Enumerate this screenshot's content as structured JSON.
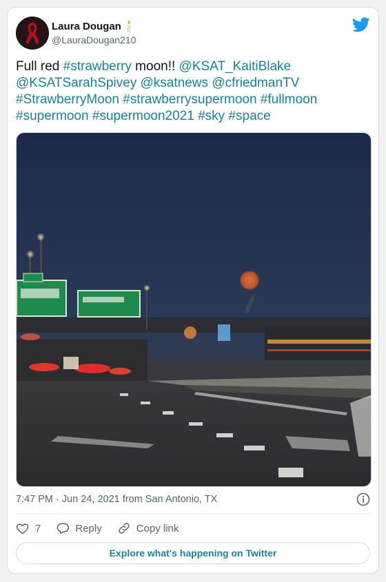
{
  "author": {
    "name": "Laura Dougan",
    "handle": "@LauraDougan210"
  },
  "tweet": {
    "parts": [
      {
        "t": "Full red ",
        "tag": false
      },
      {
        "t": "#strawberry",
        "tag": true
      },
      {
        "t": " moon!! ",
        "tag": false
      },
      {
        "t": "@KSAT_KaitiBlake",
        "tag": true
      },
      {
        "t": " ",
        "tag": false
      },
      {
        "t": "@KSATSarahSpivey",
        "tag": true
      },
      {
        "t": " ",
        "tag": false
      },
      {
        "t": "@ksatnews",
        "tag": true
      },
      {
        "t": " ",
        "tag": false
      },
      {
        "t": "@cfriedmanTV",
        "tag": true
      },
      {
        "t": " ",
        "tag": false
      },
      {
        "t": "#StrawberryMoon",
        "tag": true
      },
      {
        "t": " ",
        "tag": false
      },
      {
        "t": "#strawberrysupermoon",
        "tag": true
      },
      {
        "t": " ",
        "tag": false
      },
      {
        "t": "#fullmoon",
        "tag": true
      },
      {
        "t": " ",
        "tag": false
      },
      {
        "t": "#supermoon",
        "tag": true
      },
      {
        "t": " ",
        "tag": false
      },
      {
        "t": "#supermoon2021",
        "tag": true
      },
      {
        "t": " ",
        "tag": false
      },
      {
        "t": "#sky",
        "tag": true
      },
      {
        "t": " ",
        "tag": false
      },
      {
        "t": "#space",
        "tag": true
      }
    ]
  },
  "meta": {
    "timestamp": "7:47 PM · Jun 24, 2021 from San Antonio, TX"
  },
  "actions": {
    "like_count": "7",
    "reply_label": "Reply",
    "copy_label": "Copy link"
  },
  "explore_label": "Explore what's happening on Twitter",
  "colors": {
    "link": "#1b7f9b",
    "twitter_blue": "#1d9bf0",
    "text": "#0f1419",
    "muted": "#536471"
  }
}
